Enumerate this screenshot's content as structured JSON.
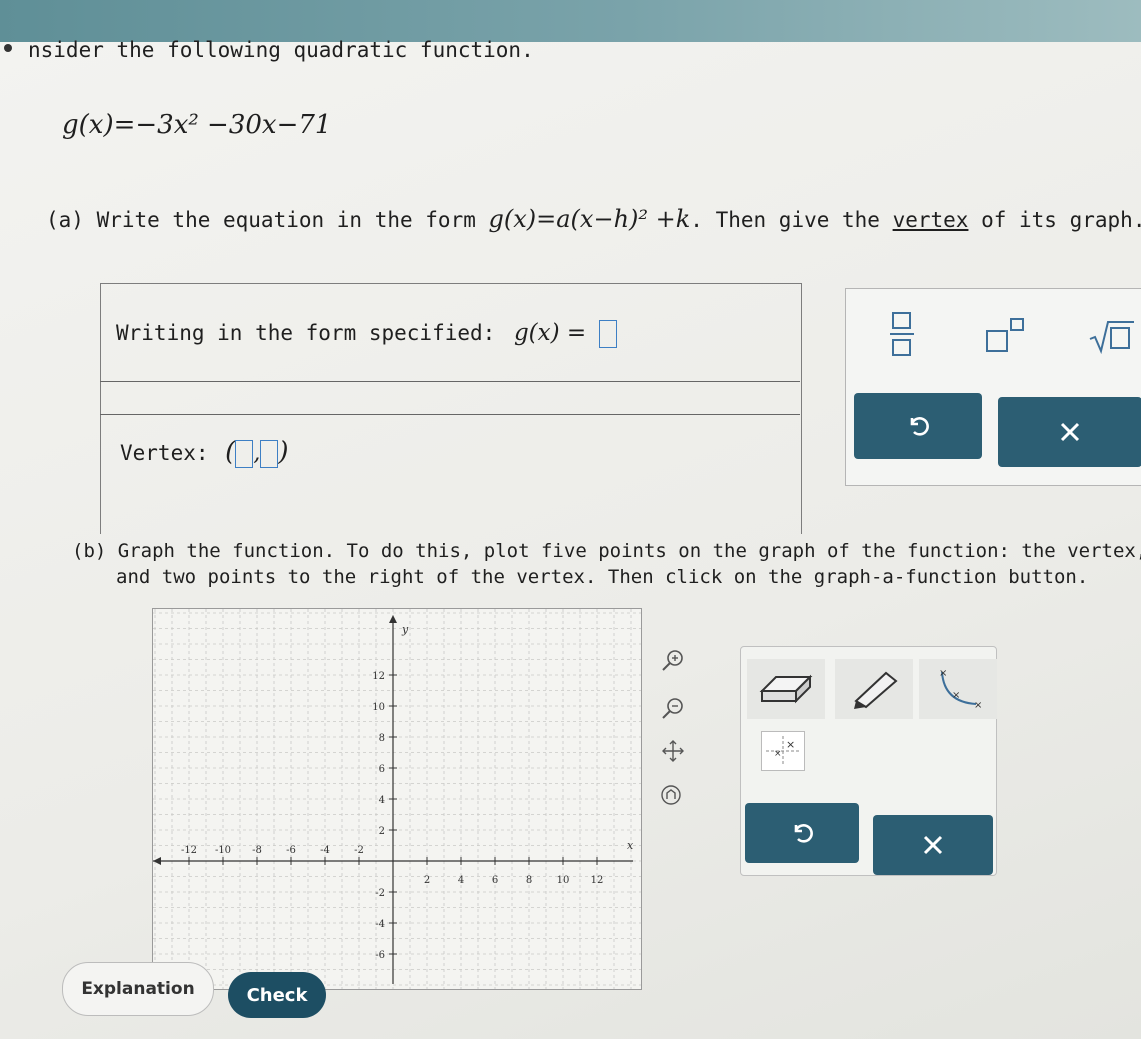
{
  "problem": {
    "intro": "nsider the following quadratic function.",
    "equation": "g(x)=−3x² −30x−71",
    "part_a_prefix": "(a) Write the equation in the form ",
    "part_a_form": "g(x)=a(x−h)² +k",
    "part_a_mid": ". Then give the ",
    "part_a_link": "vertex",
    "part_a_suffix": " of its graph.",
    "part_b_line1": "(b) Graph the function. To do this, plot five points on the graph of the function: the vertex, two",
    "part_b_line2": "and two points to the right of the vertex. Then click on the graph-a-function button."
  },
  "answer": {
    "form_label": "Writing in the form specified:",
    "form_lhs": "g(x) =",
    "vertex_label": "Vertex:"
  },
  "graph": {
    "x_label": "x",
    "y_label": "y",
    "x_ticks": [
      "-12",
      "-10",
      "-8",
      "-6",
      "-4",
      "-2",
      "2",
      "4",
      "6",
      "8",
      "10",
      "12"
    ],
    "y_ticks": [
      "12",
      "10",
      "8",
      "6",
      "4",
      "2",
      "-2",
      "-4",
      "-6"
    ]
  },
  "buttons": {
    "explanation": "Explanation",
    "check": "Check"
  },
  "colors": {
    "toolbar_button": "#2c5e73",
    "check_button": "#1d4e63",
    "input_box": "#3d7fc4",
    "palette_symbol": "#3d6f9a"
  },
  "icons": [
    "fraction-icon",
    "exponent-icon",
    "sqrt-icon",
    "undo-icon",
    "clear-icon",
    "zoom-in-icon",
    "zoom-out-icon",
    "move-icon",
    "home-icon",
    "eraser-icon",
    "pencil-icon",
    "parabola-icon",
    "graph-function-icon"
  ]
}
